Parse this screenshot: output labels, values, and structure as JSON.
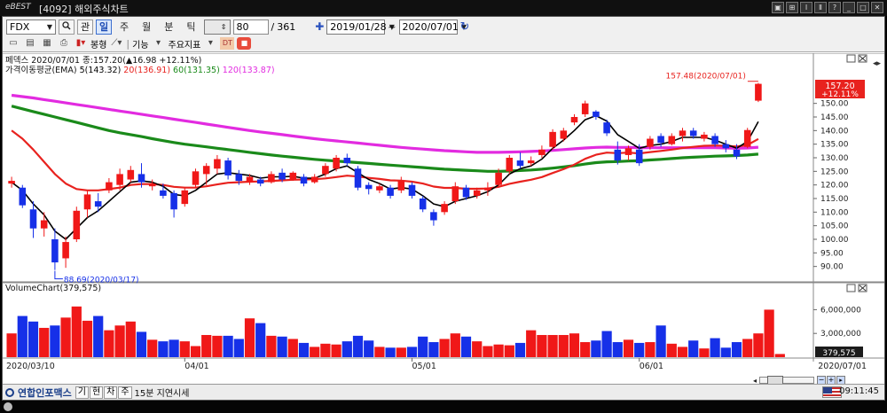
{
  "window": {
    "logo": "eBEST",
    "title": "[4092] 해외주식차트",
    "buttons": [
      "▣",
      "⊞",
      "Ⅰ",
      "Ⅱ",
      "?",
      "_",
      "□",
      "✕"
    ]
  },
  "toolbar": {
    "symbol": "FDX",
    "search_icon": "search-icon",
    "mode_label": "관",
    "periods": [
      "일",
      "주",
      "월",
      "분",
      "틱"
    ],
    "active_period": "일",
    "interval_value": "",
    "count": "80",
    "separator": "/",
    "total": "361",
    "plus": "✚",
    "start_date": "2019/01/28",
    "range_sep": "~",
    "end_date": "2020/07/01",
    "refresh_icon": "↻",
    "row2_labels": [
      "봉형",
      "기능",
      "주요지표"
    ]
  },
  "price_panel": {
    "legend1": "페덱스   2020/07/01 종:157.20(▲16.98 +12.11%)",
    "legend2_prefix": "가격이동평균(EMA) ",
    "ma": [
      {
        "label": "5(143.32)",
        "color": "#000000"
      },
      {
        "label": "20(136.91)",
        "color": "#e8221e"
      },
      {
        "label": "60(131.35)",
        "color": "#1a8a1a"
      },
      {
        "label": "120(133.87)",
        "color": "#e22be0"
      }
    ],
    "high_label": "157.48(2020/07/01)",
    "low_label": "88.69(2020/03/17)",
    "price_tag": "157.20",
    "change_tag": "+12.11%",
    "y_ticks": [
      "150.00",
      "145.00",
      "140.00",
      "135.00",
      "130.00",
      "125.00",
      "120.00",
      "115.00",
      "110.00",
      "105.00",
      "100.00",
      "95.00",
      "90.00"
    ]
  },
  "volume_panel": {
    "title": "VolumeChart(379,575)",
    "y_ticks": [
      "6,000,000",
      "3,000,000"
    ],
    "last_label": "379,575"
  },
  "x_axis": {
    "labels": [
      "2020/03/10",
      "04/01",
      "05/01",
      "06/01",
      "2020/07/01"
    ]
  },
  "bottom": {
    "source": "연합인포맥스",
    "buttons": [
      "기",
      "현",
      "차",
      "주"
    ],
    "delay": "15분 지연시세",
    "time": "09:11:45"
  },
  "colors": {
    "up": "#f01818",
    "down": "#1630e8",
    "ema5": "#000000",
    "ema20": "#e8221e",
    "ema60": "#1a8a1a",
    "ema120": "#e22be0"
  },
  "chart_data": {
    "type": "candlestick",
    "price_ylim": [
      85,
      160
    ],
    "candles": [
      {
        "o": 120.5,
        "h": 123.0,
        "l": 119.0,
        "c": 121.5
      },
      {
        "o": 119.0,
        "h": 120.0,
        "l": 111.5,
        "c": 112.5
      },
      {
        "o": 111.0,
        "h": 114.0,
        "l": 100.5,
        "c": 104.0
      },
      {
        "o": 104.0,
        "h": 110.0,
        "l": 101.0,
        "c": 107.0
      },
      {
        "o": 100.0,
        "h": 104.0,
        "l": 88.7,
        "c": 91.5
      },
      {
        "o": 93.0,
        "h": 101.0,
        "l": 89.5,
        "c": 99.0
      },
      {
        "o": 100.0,
        "h": 112.0,
        "l": 99.0,
        "c": 110.5
      },
      {
        "o": 111.0,
        "h": 118.0,
        "l": 108.0,
        "c": 116.5
      },
      {
        "o": 114.0,
        "h": 117.0,
        "l": 110.0,
        "c": 112.0
      },
      {
        "o": 118.0,
        "h": 122.5,
        "l": 117.0,
        "c": 121.0
      },
      {
        "o": 120.0,
        "h": 126.0,
        "l": 118.0,
        "c": 124.0
      },
      {
        "o": 122.0,
        "h": 127.0,
        "l": 121.0,
        "c": 125.5
      },
      {
        "o": 124.0,
        "h": 128.0,
        "l": 119.0,
        "c": 121.0
      },
      {
        "o": 119.5,
        "h": 122.0,
        "l": 118.0,
        "c": 120.5
      },
      {
        "o": 118.0,
        "h": 120.5,
        "l": 115.0,
        "c": 116.0
      },
      {
        "o": 117.0,
        "h": 118.0,
        "l": 108.0,
        "c": 111.0
      },
      {
        "o": 113.0,
        "h": 119.0,
        "l": 112.0,
        "c": 118.0
      },
      {
        "o": 120.0,
        "h": 126.0,
        "l": 119.0,
        "c": 125.0
      },
      {
        "o": 124.0,
        "h": 128.0,
        "l": 120.0,
        "c": 127.0
      },
      {
        "o": 126.0,
        "h": 131.0,
        "l": 124.0,
        "c": 129.5
      },
      {
        "o": 129.0,
        "h": 130.0,
        "l": 122.0,
        "c": 123.5
      },
      {
        "o": 124.0,
        "h": 125.5,
        "l": 120.0,
        "c": 121.5
      },
      {
        "o": 121.0,
        "h": 124.0,
        "l": 120.0,
        "c": 123.0
      },
      {
        "o": 122.0,
        "h": 123.0,
        "l": 119.5,
        "c": 120.5
      },
      {
        "o": 121.0,
        "h": 125.0,
        "l": 120.5,
        "c": 124.0
      },
      {
        "o": 124.5,
        "h": 126.0,
        "l": 121.0,
        "c": 122.0
      },
      {
        "o": 122.0,
        "h": 125.0,
        "l": 121.5,
        "c": 124.5
      },
      {
        "o": 123.0,
        "h": 124.0,
        "l": 119.5,
        "c": 120.5
      },
      {
        "o": 121.0,
        "h": 124.0,
        "l": 120.5,
        "c": 123.0
      },
      {
        "o": 124.0,
        "h": 128.0,
        "l": 123.0,
        "c": 127.0
      },
      {
        "o": 126.0,
        "h": 131.0,
        "l": 125.0,
        "c": 130.0
      },
      {
        "o": 130.0,
        "h": 131.5,
        "l": 127.0,
        "c": 128.0
      },
      {
        "o": 126.0,
        "h": 127.0,
        "l": 118.0,
        "c": 119.0
      },
      {
        "o": 120.0,
        "h": 121.0,
        "l": 116.5,
        "c": 118.5
      },
      {
        "o": 118.0,
        "h": 120.5,
        "l": 117.0,
        "c": 119.5
      },
      {
        "o": 119.0,
        "h": 120.0,
        "l": 115.0,
        "c": 116.0
      },
      {
        "o": 118.0,
        "h": 123.0,
        "l": 117.0,
        "c": 121.5
      },
      {
        "o": 120.0,
        "h": 121.0,
        "l": 115.0,
        "c": 116.0
      },
      {
        "o": 115.0,
        "h": 116.0,
        "l": 110.0,
        "c": 111.0
      },
      {
        "o": 110.0,
        "h": 111.0,
        "l": 105.0,
        "c": 107.0
      },
      {
        "o": 110.0,
        "h": 114.0,
        "l": 109.0,
        "c": 113.0
      },
      {
        "o": 114.0,
        "h": 121.0,
        "l": 113.0,
        "c": 119.5
      },
      {
        "o": 119.0,
        "h": 120.0,
        "l": 114.5,
        "c": 115.5
      },
      {
        "o": 116.0,
        "h": 119.0,
        "l": 115.0,
        "c": 118.0
      },
      {
        "o": 118.0,
        "h": 121.0,
        "l": 116.0,
        "c": 119.0
      },
      {
        "o": 120.0,
        "h": 126.0,
        "l": 119.0,
        "c": 124.5
      },
      {
        "o": 125.0,
        "h": 131.0,
        "l": 124.0,
        "c": 130.0
      },
      {
        "o": 129.0,
        "h": 132.0,
        "l": 126.0,
        "c": 127.0
      },
      {
        "o": 128.0,
        "h": 130.5,
        "l": 127.0,
        "c": 129.0
      },
      {
        "o": 131.0,
        "h": 134.5,
        "l": 130.0,
        "c": 133.0
      },
      {
        "o": 134.0,
        "h": 140.5,
        "l": 133.0,
        "c": 139.5
      },
      {
        "o": 137.0,
        "h": 141.0,
        "l": 136.0,
        "c": 140.0
      },
      {
        "o": 143.0,
        "h": 146.0,
        "l": 142.0,
        "c": 145.0
      },
      {
        "o": 146.0,
        "h": 151.0,
        "l": 145.0,
        "c": 150.0
      },
      {
        "o": 147.0,
        "h": 147.5,
        "l": 144.0,
        "c": 145.0
      },
      {
        "o": 143.0,
        "h": 144.0,
        "l": 138.0,
        "c": 139.0
      },
      {
        "o": 133.0,
        "h": 136.0,
        "l": 127.5,
        "c": 129.0
      },
      {
        "o": 131.0,
        "h": 134.5,
        "l": 129.0,
        "c": 133.5
      },
      {
        "o": 133.0,
        "h": 135.0,
        "l": 127.0,
        "c": 128.0
      },
      {
        "o": 134.0,
        "h": 138.0,
        "l": 133.0,
        "c": 137.0
      },
      {
        "o": 138.0,
        "h": 139.0,
        "l": 134.0,
        "c": 135.5
      },
      {
        "o": 135.0,
        "h": 139.0,
        "l": 134.5,
        "c": 138.0
      },
      {
        "o": 138.0,
        "h": 141.0,
        "l": 136.0,
        "c": 140.0
      },
      {
        "o": 140.0,
        "h": 141.0,
        "l": 137.0,
        "c": 138.0
      },
      {
        "o": 137.0,
        "h": 139.5,
        "l": 136.0,
        "c": 138.5
      },
      {
        "o": 138.0,
        "h": 139.0,
        "l": 134.0,
        "c": 135.0
      },
      {
        "o": 135.0,
        "h": 136.5,
        "l": 132.0,
        "c": 133.5
      },
      {
        "o": 133.0,
        "h": 135.0,
        "l": 129.5,
        "c": 130.5
      },
      {
        "o": 134.0,
        "h": 141.0,
        "l": 133.5,
        "c": 140.2
      },
      {
        "o": 151.0,
        "h": 157.5,
        "l": 150.5,
        "c": 157.2
      }
    ],
    "ema5": [
      121.0,
      118.0,
      113.0,
      109.0,
      103.0,
      100.0,
      104.0,
      108.0,
      110.5,
      114.0,
      117.5,
      121.0,
      121.5,
      121.0,
      119.5,
      116.5,
      116.0,
      118.0,
      121.0,
      124.0,
      124.5,
      124.0,
      123.5,
      122.5,
      123.0,
      123.0,
      123.2,
      122.5,
      122.5,
      124.0,
      126.0,
      127.0,
      124.5,
      122.0,
      120.5,
      118.5,
      119.0,
      118.5,
      116.0,
      113.0,
      112.0,
      114.0,
      115.0,
      116.0,
      117.5,
      120.0,
      124.0,
      126.0,
      127.0,
      129.5,
      133.5,
      136.5,
      140.0,
      144.0,
      145.5,
      143.5,
      138.5,
      136.0,
      133.5,
      134.5,
      135.0,
      136.0,
      137.5,
      137.5,
      137.5,
      136.5,
      135.0,
      133.5,
      136.0,
      143.3
    ],
    "ema20": [
      140.0,
      137.0,
      133.0,
      128.5,
      124.0,
      120.5,
      118.5,
      118.0,
      118.0,
      118.5,
      119.0,
      120.0,
      120.3,
      120.3,
      120.0,
      119.3,
      119.0,
      119.0,
      119.5,
      120.2,
      120.8,
      121.0,
      121.2,
      121.3,
      121.5,
      121.7,
      121.9,
      122.0,
      122.1,
      122.4,
      122.9,
      123.4,
      123.1,
      122.6,
      122.2,
      121.7,
      121.6,
      121.2,
      120.5,
      119.4,
      118.9,
      118.9,
      118.6,
      118.6,
      118.7,
      119.3,
      120.4,
      121.2,
      121.9,
      122.9,
      124.4,
      125.8,
      127.5,
      129.6,
      131.1,
      131.9,
      131.7,
      131.9,
      131.6,
      132.1,
      132.5,
      133.0,
      133.6,
      134.0,
      134.4,
      134.5,
      134.4,
      134.1,
      134.7,
      136.9
    ],
    "ema60": [
      149.0,
      148.0,
      147.0,
      146.0,
      145.0,
      144.0,
      143.0,
      142.0,
      141.0,
      140.0,
      139.2,
      138.5,
      137.8,
      137.0,
      136.3,
      135.6,
      135.0,
      134.5,
      134.0,
      133.5,
      133.0,
      132.5,
      132.0,
      131.5,
      131.0,
      130.6,
      130.2,
      129.8,
      129.4,
      129.1,
      128.8,
      128.5,
      128.2,
      127.9,
      127.6,
      127.3,
      127.0,
      126.7,
      126.4,
      126.1,
      125.8,
      125.6,
      125.4,
      125.2,
      125.0,
      125.0,
      125.1,
      125.3,
      125.5,
      125.8,
      126.2,
      126.6,
      127.1,
      127.7,
      128.2,
      128.5,
      128.6,
      128.8,
      128.9,
      129.2,
      129.4,
      129.7,
      130.0,
      130.2,
      130.4,
      130.6,
      130.7,
      130.8,
      131.0,
      131.35
    ],
    "ema120": [
      153.0,
      152.5,
      152.0,
      151.4,
      150.8,
      150.2,
      149.6,
      149.0,
      148.4,
      147.8,
      147.2,
      146.6,
      146.0,
      145.4,
      144.8,
      144.2,
      143.6,
      143.0,
      142.4,
      141.8,
      141.2,
      140.6,
      140.0,
      139.5,
      139.0,
      138.5,
      138.0,
      137.5,
      137.0,
      136.6,
      136.2,
      135.8,
      135.4,
      135.0,
      134.6,
      134.2,
      133.8,
      133.5,
      133.2,
      132.9,
      132.6,
      132.4,
      132.2,
      132.0,
      132.0,
      132.0,
      132.1,
      132.2,
      132.3,
      132.5,
      132.7,
      133.0,
      133.3,
      133.6,
      133.8,
      133.9,
      133.8,
      133.8,
      133.7,
      133.7,
      133.7,
      133.7,
      133.7,
      133.7,
      133.7,
      133.7,
      133.6,
      133.5,
      133.6,
      133.87
    ],
    "volume_ylim": [
      0,
      7500000
    ],
    "volumes": [
      3000000,
      5200000,
      4500000,
      3700000,
      4000000,
      5000000,
      6400000,
      4600000,
      5200000,
      3400000,
      4000000,
      4500000,
      3200000,
      2200000,
      2000000,
      2200000,
      2000000,
      1400000,
      2800000,
      2700000,
      2700000,
      2300000,
      4900000,
      4300000,
      2700000,
      2600000,
      2300000,
      1800000,
      1300000,
      1700000,
      1600000,
      2000000,
      2700000,
      2100000,
      1300000,
      1200000,
      1200000,
      1300000,
      2600000,
      1900000,
      2300000,
      3000000,
      2600000,
      2000000,
      1400000,
      1600000,
      1500000,
      1800000,
      3400000,
      2800000,
      2800000,
      2800000,
      3000000,
      1900000,
      2100000,
      3300000,
      1900000,
      2200000,
      1800000,
      1900000,
      4000000,
      1700000,
      1300000,
      2100000,
      1100000,
      2400000,
      1200000,
      1900000,
      2300000,
      3000000,
      6000000,
      400000
    ],
    "volume_unit": "shares"
  }
}
